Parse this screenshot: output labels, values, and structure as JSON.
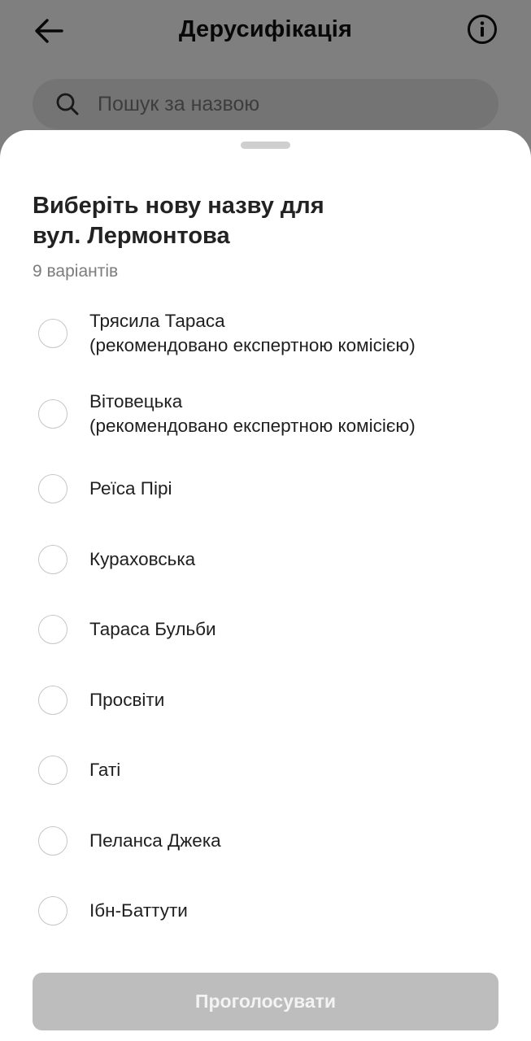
{
  "header": {
    "title": "Дерусифікація",
    "back_icon": "arrow-left-icon",
    "info_icon": "info-icon"
  },
  "search": {
    "placeholder": "Пошук за назвою",
    "value": "",
    "icon": "search-icon"
  },
  "sheet": {
    "title_line1": "Виберіть нову назву для",
    "title_line2": "вул. Лермонтова",
    "subtitle": "9 варіантів",
    "options": [
      {
        "label": "Трясила Тараса",
        "note": "(рекомендовано експертною комісією)",
        "selected": false
      },
      {
        "label": "Вітовецька",
        "note": "(рекомендовано експертною комісією)",
        "selected": false
      },
      {
        "label": "Реїса Пірі",
        "note": "",
        "selected": false
      },
      {
        "label": "Кураховська",
        "note": "",
        "selected": false
      },
      {
        "label": "Тараса Бульби",
        "note": "",
        "selected": false
      },
      {
        "label": "Просвіти",
        "note": "",
        "selected": false
      },
      {
        "label": "Гаті",
        "note": "",
        "selected": false
      },
      {
        "label": "Пеланса Джека",
        "note": "",
        "selected": false
      },
      {
        "label": "Ібн-Баттути",
        "note": "",
        "selected": false
      }
    ],
    "vote_button": "Проголосувати",
    "vote_enabled": false
  },
  "colors": {
    "scrim": "#000000",
    "button_disabled": "#bdbdbd",
    "radio_border": "#c6c6c6",
    "subtitle": "#7c7c7c"
  }
}
